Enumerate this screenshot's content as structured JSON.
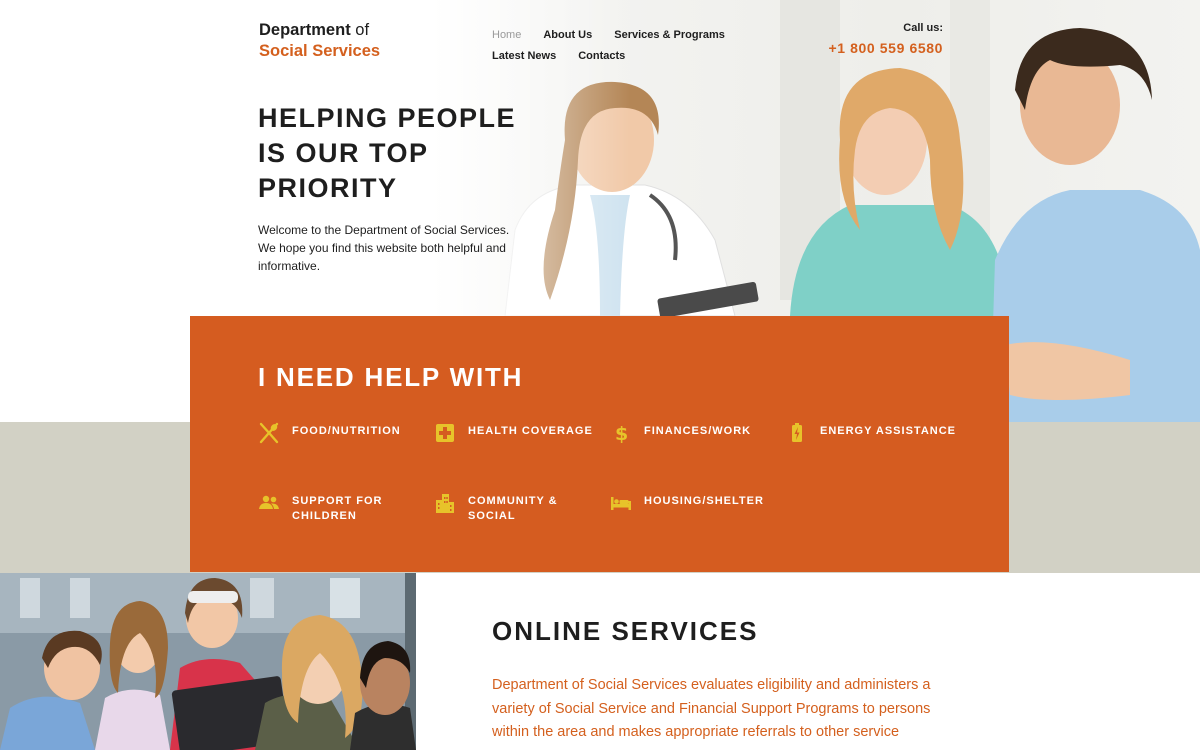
{
  "brand": {
    "line1_main": "Department",
    "line1_of": " of",
    "line2": "Social Services"
  },
  "nav": {
    "items": [
      {
        "label": "Home",
        "active": true
      },
      {
        "label": "About Us"
      },
      {
        "label": "Services & Programs"
      },
      {
        "label": "Latest News"
      },
      {
        "label": "Contacts"
      }
    ]
  },
  "call": {
    "label": "Call us:",
    "number": "+1 800 559 6580"
  },
  "hero": {
    "headline": [
      "HELPING PEOPLE",
      "IS OUR TOP",
      "PRIORITY"
    ],
    "intro": "Welcome to the Department of Social Services. We hope you find this website both helpful and informative."
  },
  "help": {
    "title": "I NEED HELP WITH",
    "items": [
      {
        "label": "FOOD/NUTRITION",
        "icon": "utensils-icon"
      },
      {
        "label": "HEALTH COVERAGE",
        "icon": "medical-cross-icon"
      },
      {
        "label": "FINANCES/WORK",
        "icon": "dollar-icon"
      },
      {
        "label": "ENERGY ASSISTANCE",
        "icon": "battery-bolt-icon"
      },
      {
        "label": "SUPPORT FOR CHILDREN",
        "icon": "people-icon"
      },
      {
        "label": "COMMUNITY & SOCIAL",
        "icon": "buildings-icon"
      },
      {
        "label": "HOUSING/SHELTER",
        "icon": "bed-icon"
      }
    ]
  },
  "online": {
    "title": "ONLINE SERVICES",
    "text": "Department of Social Services evaluates eligibility and administers a variety of Social Service and Financial Support Programs to persons within the area and makes appropriate referrals to other service"
  },
  "colors": {
    "accent": "#d4601e",
    "panel": "#d55c20",
    "icon": "#e7c32a",
    "band": "#d2d1c5",
    "text": "#1e1e1e"
  }
}
